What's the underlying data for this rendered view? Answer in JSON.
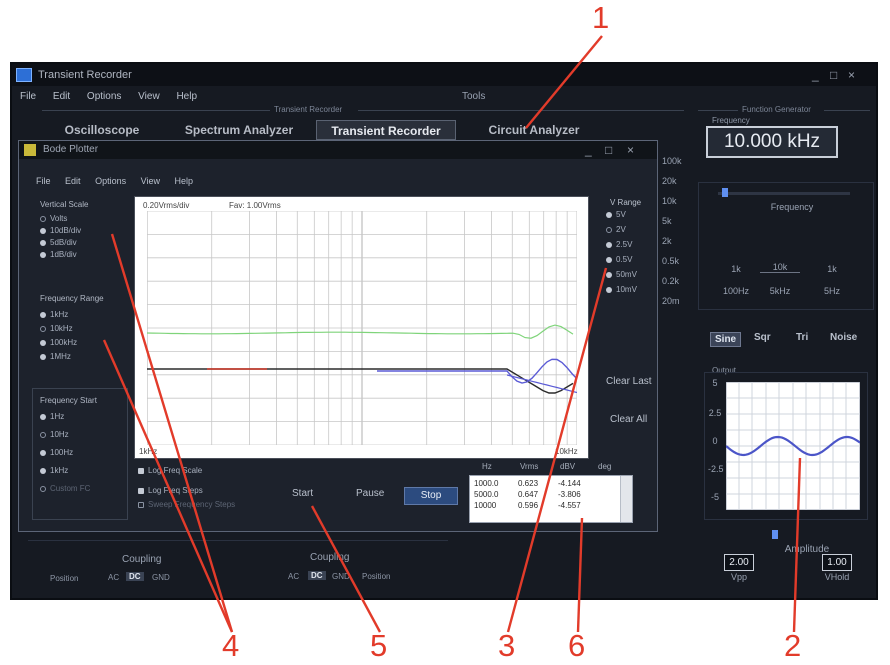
{
  "main": {
    "title": "Transient Recorder",
    "menu": [
      "File",
      "Edit",
      "Options",
      "View",
      "Help"
    ],
    "menu_right": "Tools",
    "group_label_center": "Transient Recorder",
    "group_label_right": "Function Generator",
    "tabs": [
      {
        "label": "Oscilloscope",
        "active": false
      },
      {
        "label": "Spectrum Analyzer",
        "active": false
      },
      {
        "label": "Transient Recorder",
        "active": true
      },
      {
        "label": "Circuit Analyzer",
        "active": false
      }
    ],
    "win_controls": [
      "_",
      "□",
      "×"
    ]
  },
  "function_generator": {
    "freq_label": "Frequency",
    "freq_value": "10.000 kHz",
    "slider_label": "Frequency",
    "ranges_top": [
      "1k",
      "10k",
      "1k"
    ],
    "ranges_bottom": [
      "100Hz",
      "5kHz",
      "5Hz"
    ],
    "waveforms": [
      {
        "label": "Sine",
        "active": true
      },
      {
        "label": "Sqr",
        "active": false
      },
      {
        "label": "Tri",
        "active": false
      },
      {
        "label": "Noise",
        "active": false
      }
    ],
    "output_label": "Output",
    "y_ticks": [
      "5",
      "2.5",
      "0",
      "-2.5",
      "-5"
    ],
    "amplitude_label": "Amplitude",
    "vpp_value": "2.00",
    "vpp_label": "Vpp",
    "voffset_value": "1.00",
    "voffset_label": "VHold"
  },
  "bode": {
    "title": "Bode Plotter",
    "win_controls": [
      "_",
      "□",
      "×"
    ],
    "menu": [
      "File",
      "Edit",
      "Options",
      "View",
      "Help"
    ],
    "vertical_scale_label": "Vertical Scale",
    "vertical_scale_options": [
      {
        "label": "Volts",
        "selected": false
      },
      {
        "label": "10dB/div",
        "selected": true
      },
      {
        "label": "5dB/div",
        "selected": true
      },
      {
        "label": "1dB/div",
        "selected": true
      }
    ],
    "frequency_range_label": "Frequency Range",
    "frequency_range_options": [
      {
        "label": "1kHz",
        "selected": true
      },
      {
        "label": "10kHz",
        "selected": false
      },
      {
        "label": "100kHz",
        "selected": true
      },
      {
        "label": "1MHz",
        "selected": true
      }
    ],
    "frequency_start_label": "Frequency Start",
    "frequency_start_options": [
      {
        "label": "1Hz",
        "selected": true
      },
      {
        "label": "10Hz",
        "selected": false
      },
      {
        "label": "100Hz",
        "selected": true
      },
      {
        "label": "1kHz",
        "selected": true
      },
      {
        "label": "Custom FC",
        "selected": false
      }
    ],
    "plot_header_left": "0.20Vrms/div",
    "plot_header_right": "Fav: 1.00Vrms",
    "x_min_label": "1kHz",
    "x_max_label": "10kHz",
    "v_range_label": "V Range",
    "v_range_options": [
      {
        "label": "5V",
        "selected": true
      },
      {
        "label": "2V",
        "selected": false
      },
      {
        "label": "2.5V",
        "selected": true
      },
      {
        "label": "0.5V",
        "selected": true
      },
      {
        "label": "50mV",
        "selected": true
      },
      {
        "label": "10mV",
        "selected": true
      }
    ],
    "side_values": [
      "100k",
      "20k",
      "10k",
      "5k",
      "2k",
      "0.5k",
      "0.2k",
      "20m"
    ],
    "clear_last": "Clear Last",
    "clear_all": "Clear All",
    "checkbox_log_freq": "Log Freq Scale",
    "checkbox_log_steps": "Log Freq Steps",
    "checkbox_extra": "Sweep Frequency Steps",
    "start_label": "Start",
    "pause_label": "Pause",
    "stop_label": "Stop",
    "table": {
      "headers": [
        "Hz",
        "Vrms",
        "dBV",
        "deg"
      ],
      "rows": [
        [
          "1000.0",
          "0.623",
          "-4.144"
        ],
        [
          "5000.0",
          "0.647",
          "-3.806"
        ],
        [
          "10000",
          "0.596",
          "-4.557"
        ]
      ]
    }
  },
  "bottom": {
    "left_coupling_label": "Coupling",
    "left_position": "Position",
    "left_opts": [
      "AC",
      "DC",
      "GND"
    ],
    "right_coupling_label": "Coupling",
    "right_opts": [
      "AC",
      "DC",
      "GND"
    ],
    "right_position": "Position"
  },
  "annotations": [
    "1",
    "2",
    "3",
    "4",
    "5",
    "6"
  ],
  "colors": {
    "annotation": "#e23b2a",
    "trace_green": "#7fd47a",
    "trace_dark": "#2b2b2b",
    "trace_red": "#d23a2a",
    "trace_blue": "#5b5bd6",
    "fg_wave": "#4b55c8"
  }
}
